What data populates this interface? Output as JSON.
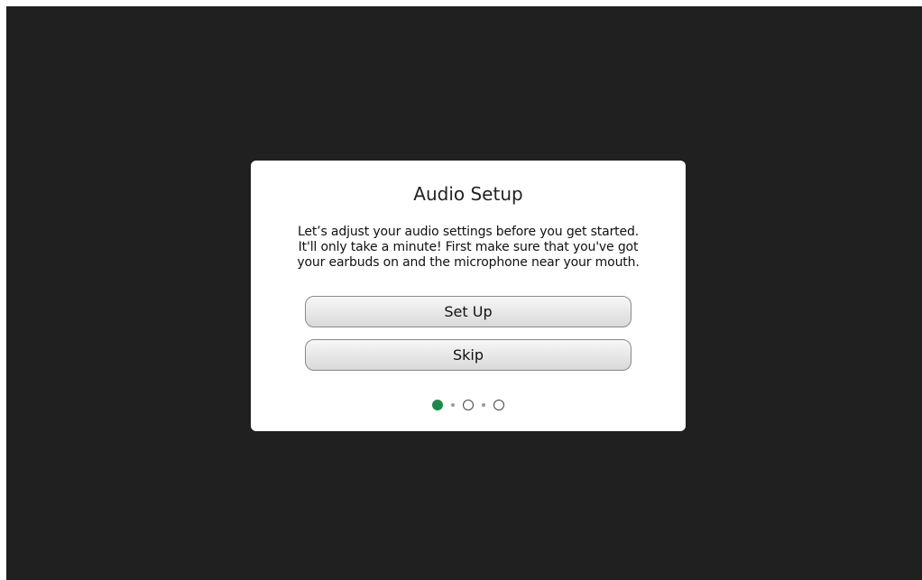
{
  "dialog": {
    "title": "Audio Setup",
    "message": "Let’s adjust your audio settings before you get started.\nIt'll only take a minute! First make sure that you've got\nyour earbuds on and the microphone near your mouth.",
    "setup_label": "Set Up",
    "skip_label": "Skip"
  },
  "pager": {
    "steps": 3,
    "current_step": 1,
    "active_color": "#1a8a4a"
  }
}
